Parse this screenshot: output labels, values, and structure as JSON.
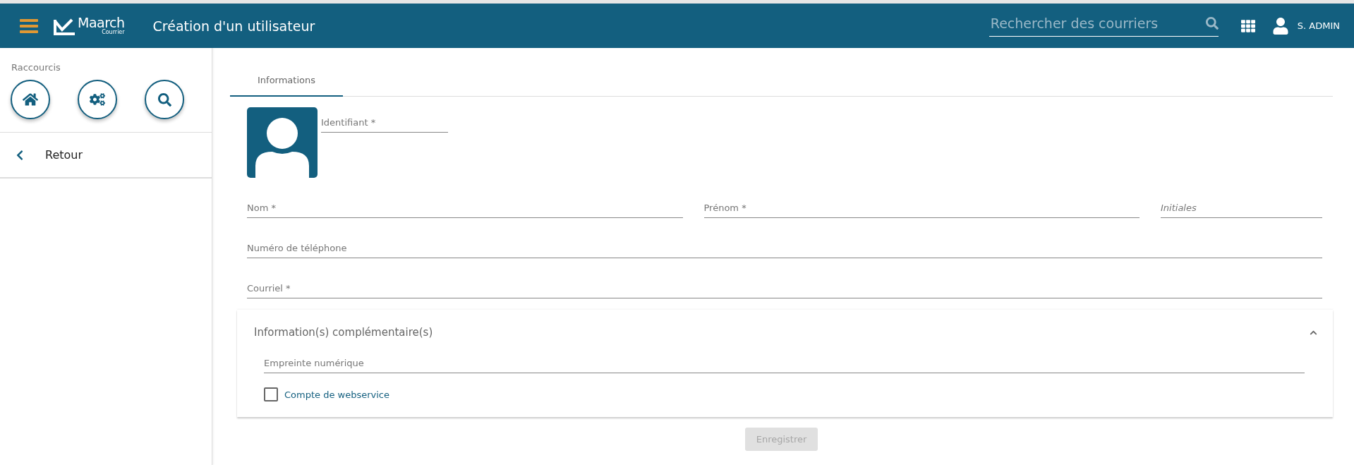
{
  "header": {
    "title": "Création d'un utilisateur",
    "logo": {
      "name": "Maarch",
      "sub": "Courrier"
    },
    "search": {
      "placeholder": "Rechercher des courriers"
    },
    "user": "S. ADMIN"
  },
  "sidebar": {
    "shortcuts_title": "Raccourcis",
    "back": "Retour"
  },
  "tabs": [
    {
      "label": "Informations",
      "selected": true
    }
  ],
  "identifier": {
    "placeholder": "Identifiant *"
  },
  "rows": [
    [
      {
        "placeholder": "Nom *",
        "italic": false
      },
      {
        "placeholder": "Prénom *",
        "italic": false
      },
      {
        "placeholder": "Initiales",
        "italic": true
      }
    ],
    [
      {
        "placeholder": "Numéro de téléphone",
        "italic": false
      }
    ],
    [
      {
        "placeholder": "Courriel *",
        "italic": false
      }
    ]
  ],
  "panel": {
    "title": "Information(s) complémentaire(s)",
    "expanded": true,
    "field": {
      "placeholder": "Empreinte numérique"
    },
    "checkbox": {
      "label": "Compte de webservice",
      "checked": false
    }
  },
  "save": {
    "label": "Enregistrer",
    "disabled": true
  }
}
